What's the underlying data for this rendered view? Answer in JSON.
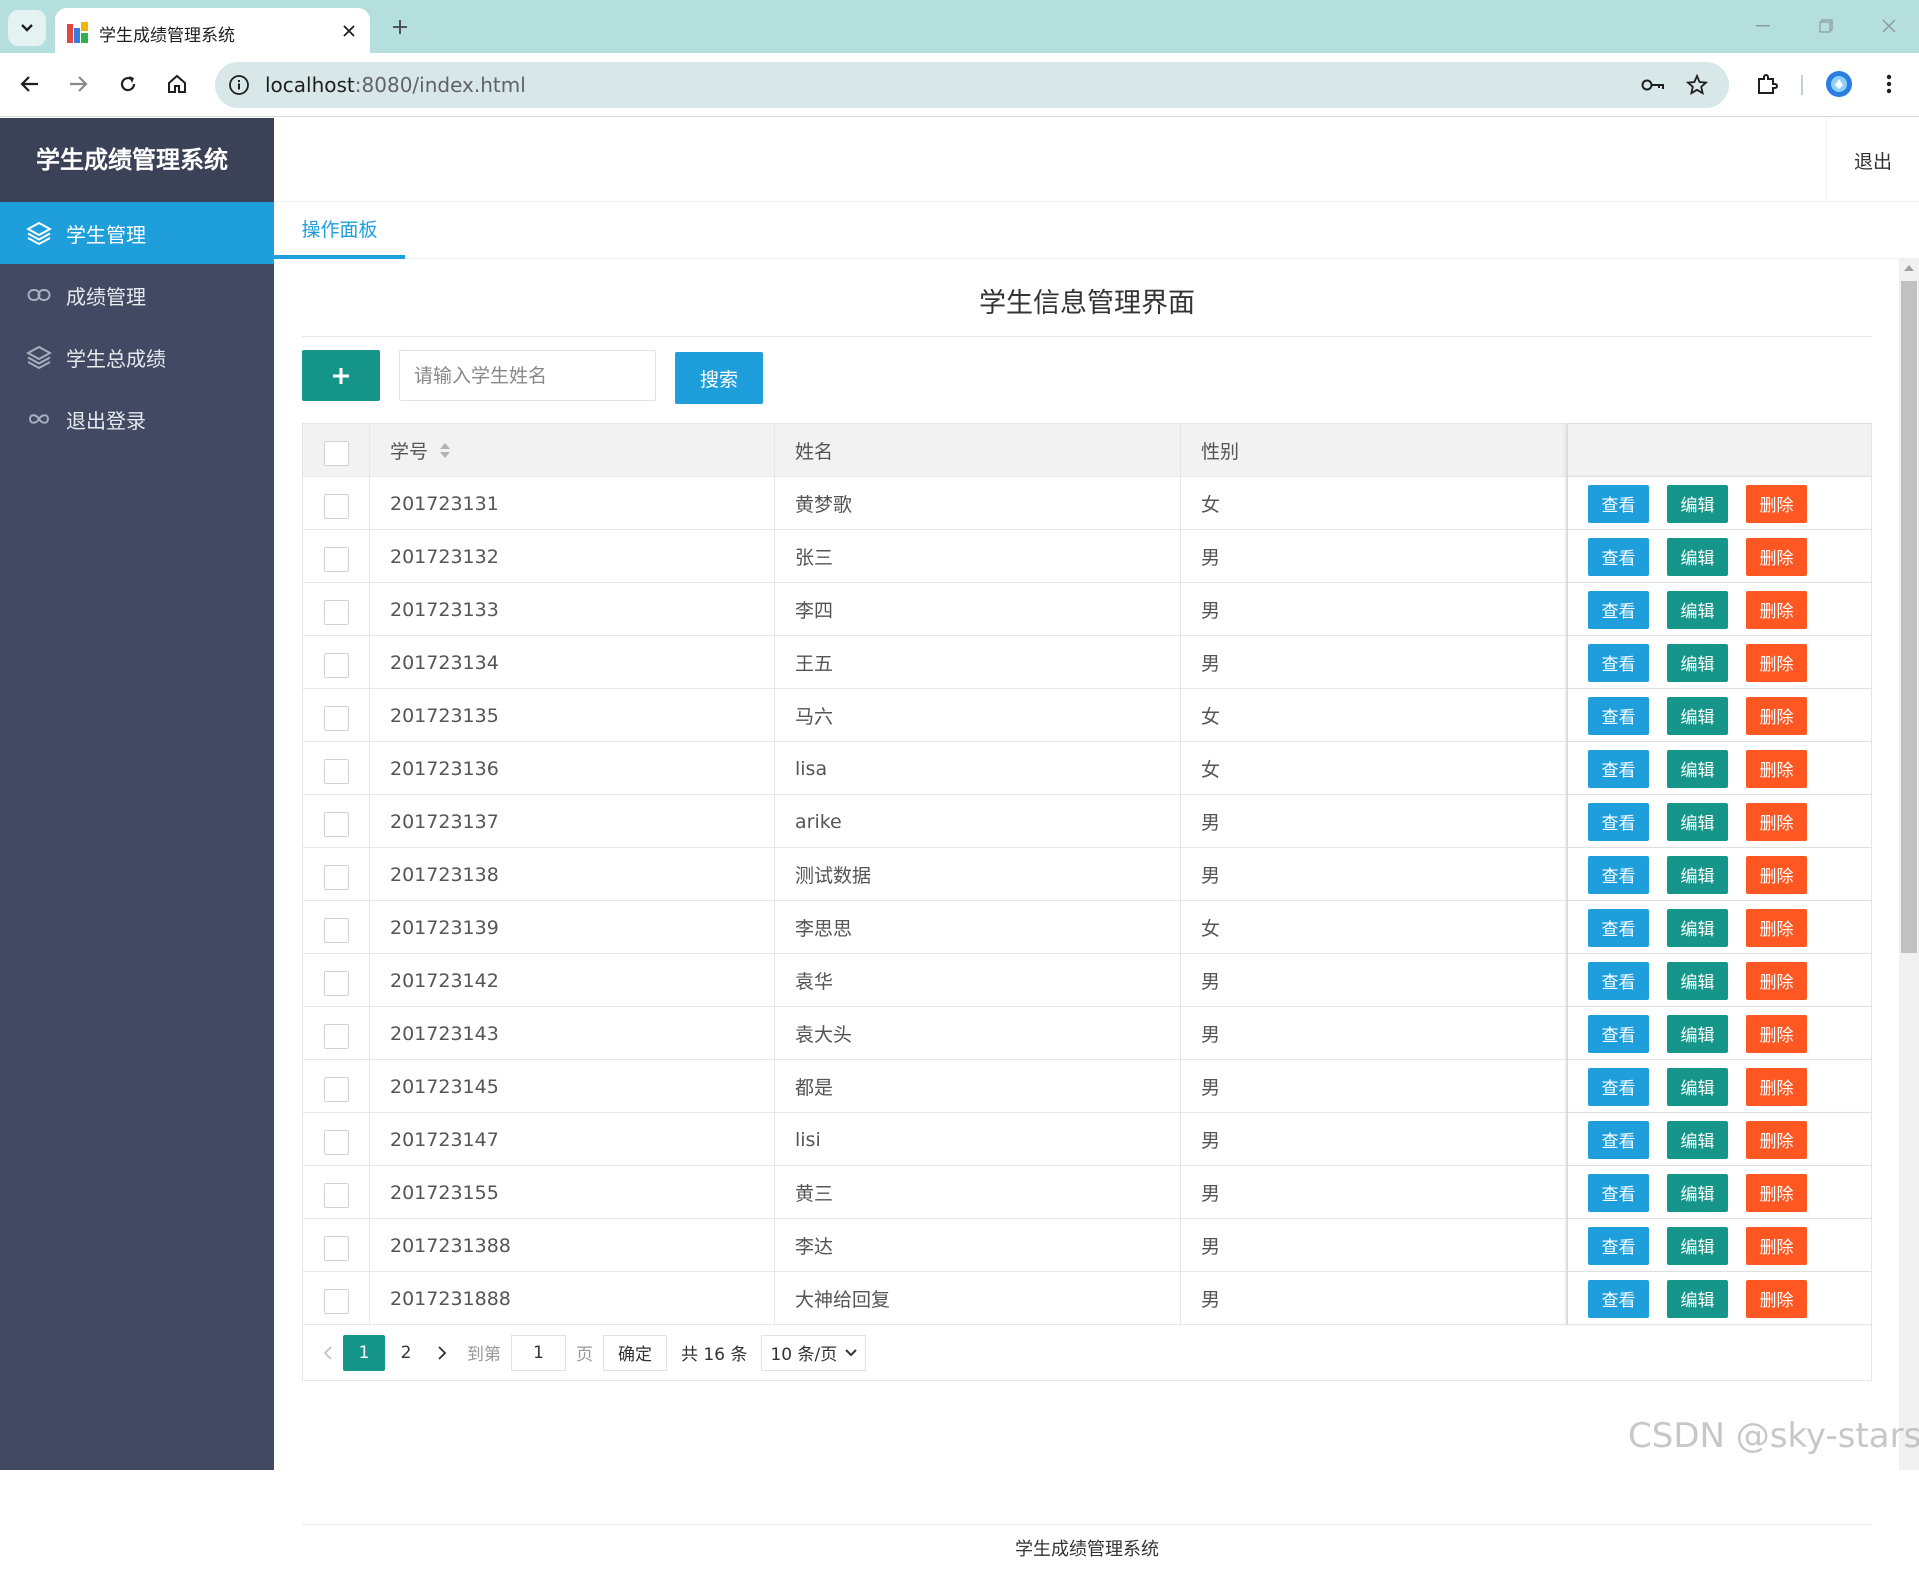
{
  "browser": {
    "tab_title": "学生成绩管理系统",
    "url_host": "localhost",
    "url_rest": ":8080/index.html"
  },
  "app": {
    "logo": "学生成绩管理系统",
    "logout_top": "退出",
    "sidebar": [
      {
        "label": "学生管理",
        "icon": "layers-icon",
        "active": true
      },
      {
        "label": "成绩管理",
        "icon": "link-icon",
        "active": false
      },
      {
        "label": "学生总成绩",
        "icon": "layers-icon",
        "active": false
      },
      {
        "label": "退出登录",
        "icon": "infinity-icon",
        "active": false
      }
    ],
    "tab": "操作面板",
    "page_title": "学生信息管理界面",
    "add_button": "+",
    "search": {
      "placeholder": "请输入学生姓名",
      "value": "",
      "button": "搜索"
    },
    "table": {
      "headers": {
        "id": "学号",
        "name": "姓名",
        "sex": "性别"
      },
      "ops": {
        "view": "查看",
        "edit": "编辑",
        "del": "删除"
      },
      "rows": [
        {
          "id": "201723131",
          "name": "黄梦歌",
          "sex": "女"
        },
        {
          "id": "201723132",
          "name": "张三",
          "sex": "男"
        },
        {
          "id": "201723133",
          "name": "李四",
          "sex": "男"
        },
        {
          "id": "201723134",
          "name": "王五",
          "sex": "男"
        },
        {
          "id": "201723135",
          "name": "马六",
          "sex": "女"
        },
        {
          "id": "201723136",
          "name": "lisa",
          "sex": "女"
        },
        {
          "id": "201723137",
          "name": "arike",
          "sex": "男"
        },
        {
          "id": "201723138",
          "name": "测试数据",
          "sex": "男"
        },
        {
          "id": "201723139",
          "name": "李思思",
          "sex": "女"
        },
        {
          "id": "201723142",
          "name": "袁华",
          "sex": "男"
        },
        {
          "id": "201723143",
          "name": "袁大头",
          "sex": "男"
        },
        {
          "id": "201723145",
          "name": "都是",
          "sex": "男"
        },
        {
          "id": "201723147",
          "name": "lisi",
          "sex": "男"
        },
        {
          "id": "201723155",
          "name": "黄三",
          "sex": "男"
        },
        {
          "id": "2017231388",
          "name": "李达",
          "sex": "男"
        },
        {
          "id": "2017231888",
          "name": "大神给回复",
          "sex": "男"
        }
      ]
    },
    "pager": {
      "current": "1",
      "next_page": "2",
      "goto_label": "到第",
      "goto_value": "1",
      "page_label": "页",
      "confirm": "确定",
      "total": "共 16 条",
      "page_size": "10 条/页"
    },
    "footer": "学生成绩管理系统"
  },
  "watermark": "CSDN @sky-stars",
  "colors": {
    "sidebar_bg": "#424a63",
    "accent_blue": "#1e9fdc",
    "accent_green": "#16968a",
    "danger_orange": "#ff5722"
  }
}
